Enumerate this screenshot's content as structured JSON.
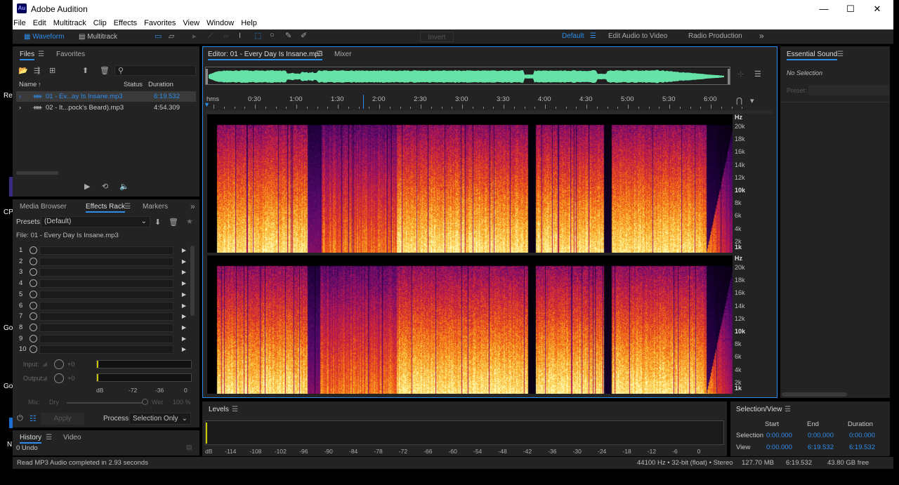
{
  "window": {
    "title": "Adobe Audition",
    "logo": "Au",
    "minimize": "—",
    "maximize": "☐",
    "close": "✕"
  },
  "menu": [
    "File",
    "Edit",
    "Multitrack",
    "Clip",
    "Effects",
    "Favorites",
    "View",
    "Window",
    "Help"
  ],
  "toolbar": {
    "waveform": "Waveform",
    "multitrack": "Multitrack",
    "invert": "Invert",
    "workspaces": [
      "Default",
      "Edit Audio to Video",
      "Radio Production"
    ],
    "overflow": "»"
  },
  "files": {
    "tab_files": "Files",
    "tab_favorites": "Favorites",
    "col_name": "Name",
    "col_status": "Status",
    "col_duration": "Duration",
    "rows": [
      {
        "name": "01 - Ev...ay Is Insane.mp3",
        "duration": "6:19.532",
        "selected": true
      },
      {
        "name": "02 - It...pock's Beard).mp3",
        "duration": "4:54.309",
        "selected": false
      }
    ]
  },
  "effects": {
    "tab_media": "Media Browser",
    "tab_rack": "Effects Rack",
    "tab_markers": "Markers",
    "presets_label": "Presets:",
    "presets_value": "(Default)",
    "file_label": "File: 01 - Every Day Is Insane.mp3",
    "slots": [
      "1",
      "2",
      "3",
      "4",
      "5",
      "6",
      "7",
      "8",
      "9",
      "10"
    ],
    "input_label": "Input:",
    "input_val": "+0",
    "output_label": "Output:",
    "output_val": "+0",
    "meter_scale": [
      "dB",
      "-72",
      "-36",
      "0"
    ],
    "mix_label": "Mix:",
    "dry": "Dry",
    "wet": "Wet",
    "wet_pct": "100 %",
    "apply": "Apply",
    "process_label": "Process:",
    "process_value": "Selection Only"
  },
  "history": {
    "tab_history": "History",
    "tab_video": "Video",
    "entry": "0 Undo"
  },
  "editor": {
    "tab_editor": "Editor: 01 - Every Day Is Insane.mp3",
    "tab_mixer": "Mixer",
    "ruler": [
      "hms",
      "0:30",
      "1:00",
      "1:30",
      "2:00",
      "2:30",
      "3:00",
      "3:30",
      "4:00",
      "4:30",
      "5:00",
      "5:30",
      "6:00"
    ],
    "hz_labels": [
      "Hz",
      "20k",
      "18k",
      "16k",
      "14k",
      "12k",
      "10k",
      "8k",
      "6k",
      "4k",
      "2k",
      "1k"
    ]
  },
  "levels": {
    "title": "Levels",
    "scale": [
      "dB",
      "-114",
      "-108",
      "-102",
      "-96",
      "-90",
      "-84",
      "-78",
      "-72",
      "-66",
      "-60",
      "-54",
      "-48",
      "-42",
      "-36",
      "-30",
      "-24",
      "-18",
      "-12",
      "-6",
      "0"
    ]
  },
  "selection_view": {
    "title": "Selection/View",
    "start": "Start",
    "end": "End",
    "duration": "Duration",
    "selection_label": "Selection",
    "sel_start": "0:00.000",
    "sel_end": "0:00.000",
    "sel_dur": "0:00.000",
    "view_label": "View",
    "view_start": "0:00.000",
    "view_end": "6:19.532",
    "view_dur": "6:19.532"
  },
  "essential": {
    "title": "Essential Sound",
    "no_selection": "No Selection",
    "preset": "Preset:"
  },
  "status": {
    "message": "Read MP3 Audio completed in 2.93 seconds",
    "format": "44100 Hz • 32-bit (float) • Stereo",
    "size": "127.70 MB",
    "duration": "6:19.532",
    "free": "43.80 GB free"
  },
  "desktop_fragments": [
    "Re",
    "CP",
    "Go",
    "Go",
    "N"
  ]
}
